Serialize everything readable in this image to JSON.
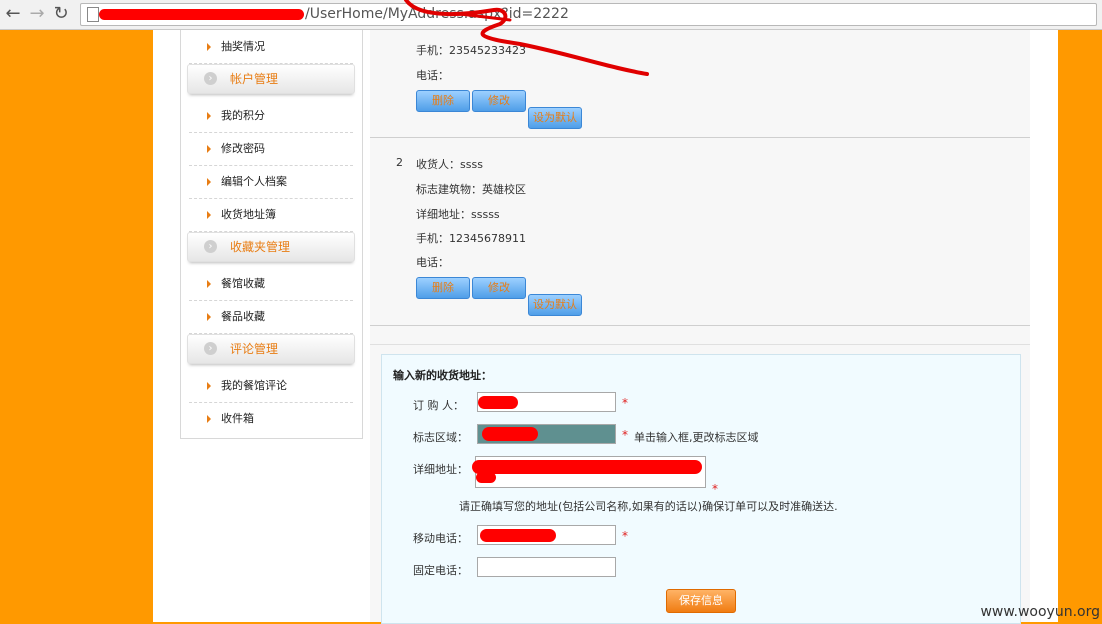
{
  "browser": {
    "url": "/UserHome/MyAddress.aspx?id=2222",
    "back_icon": "arrow-left-icon",
    "forward_icon": "arrow-right-icon",
    "reload_icon": "reload-icon"
  },
  "sidebar": {
    "items_top": [
      "抽奖情况"
    ],
    "group1": {
      "title": "帐户管理",
      "items": [
        "我的积分",
        "修改密码",
        "编辑个人档案",
        "收货地址簿"
      ]
    },
    "group2": {
      "title": "收藏夹管理",
      "items": [
        "餐馆收藏",
        "餐品收藏"
      ]
    },
    "group3": {
      "title": "评论管理",
      "items": [
        "我的餐馆评论",
        "收件箱"
      ]
    }
  },
  "address1": {
    "mobile": "手机：23545233423",
    "phone": "电话："
  },
  "address2": {
    "index": "2",
    "receiver": "收货人：ssss",
    "landmark": "标志建筑物：英雄校区",
    "detail": "详细地址：sssss",
    "mobile": "手机：12345678911",
    "phone": "电话："
  },
  "buttons": {
    "delete": "删除",
    "edit": "修改",
    "set_default": "设为默认"
  },
  "form": {
    "title": "输入新的收货地址：",
    "orderer_label": "订 购 人：",
    "area_label": "标志区域：",
    "area_hint": "单击输入框,更改标志区域",
    "detail_label": "详细地址：",
    "detail_note": "请正确填写您的地址(包括公司名称,如果有的话以)确保订单可以及时准确送达.",
    "mobile_label": "移动电话：",
    "phone_label": "固定电话：",
    "required_mark": "*",
    "save": "保存信息"
  },
  "watermark": "www.wooyun.org",
  "colors": {
    "accent": "#ff9900",
    "link_orange": "#e87d14",
    "button_blue": "#4f9ee8"
  }
}
